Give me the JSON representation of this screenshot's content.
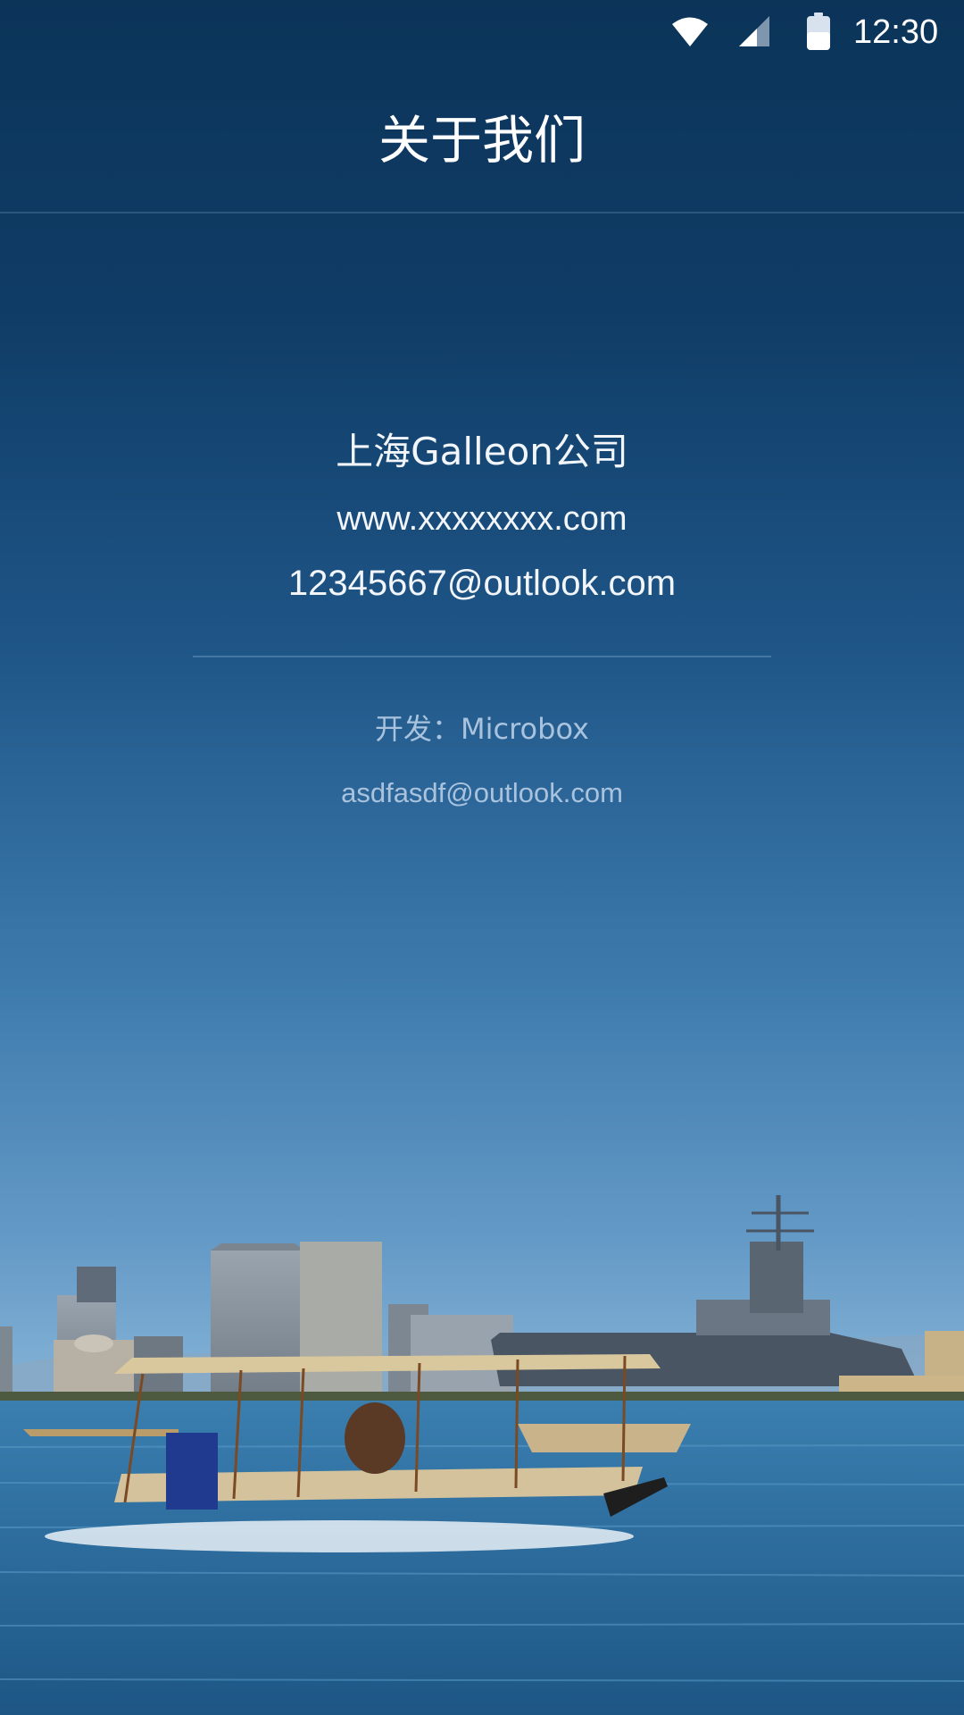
{
  "status_bar": {
    "time": "12:30",
    "icons": [
      "wifi-icon",
      "cell-signal-icon",
      "battery-icon"
    ]
  },
  "app_bar": {
    "title": "关于我们"
  },
  "company": {
    "name": "上海Galleon公司",
    "website": "www.xxxxxxxx.com",
    "email": "12345667@outlook.com"
  },
  "developer": {
    "label": "开发：Microbox",
    "email": "asdfasdf@outlook.com"
  },
  "colors": {
    "bg_top": "#0c3459",
    "bg_bottom": "#80afd4",
    "text_primary": "#ffffff",
    "text_secondary": "#a9c3de",
    "water": "#2f6f9f"
  },
  "background_image": {
    "subject": "harbor-skyline-with-biplane-on-water"
  }
}
